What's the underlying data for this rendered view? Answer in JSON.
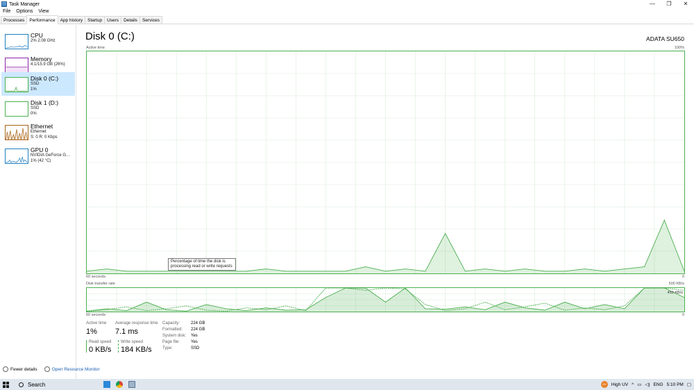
{
  "window": {
    "title": "Task Manager",
    "minimize": "—",
    "restore": "❐",
    "close": "✕"
  },
  "menu": [
    "File",
    "Options",
    "View"
  ],
  "tabs": [
    "Processes",
    "Performance",
    "App history",
    "Startup",
    "Users",
    "Details",
    "Services"
  ],
  "active_tab": "Performance",
  "sidebar": [
    {
      "name": "CPU",
      "sub1": "2% 2.08 GHz",
      "sub2": "",
      "sub3": "",
      "color": "#1f7fbf"
    },
    {
      "name": "Memory",
      "sub1": "4.1/15.9 GB (26%)",
      "sub2": "",
      "sub3": "",
      "color": "#8b24a8"
    },
    {
      "name": "Disk 0 (C:)",
      "sub1": "SSD",
      "sub2": "1%",
      "sub3": "",
      "color": "#4caf50"
    },
    {
      "name": "Disk 1 (D:)",
      "sub1": "SSD",
      "sub2": "0%",
      "sub3": "",
      "color": "#4caf50"
    },
    {
      "name": "Ethernet",
      "sub1": "Ethernet",
      "sub2": "S: 0 R: 0 Kbps",
      "sub3": "",
      "color": "#a7641c"
    },
    {
      "name": "GPU 0",
      "sub1": "NVIDIA GeForce G...",
      "sub2": "1% (42 °C)",
      "sub3": "",
      "color": "#1f7fbf"
    }
  ],
  "main": {
    "title": "Disk 0 (C:)",
    "model": "ADATA SU650",
    "active_time_label": "Active time",
    "active_max": "100%",
    "chart1_xlabel": "60 seconds",
    "chart1_xend": "0",
    "transfer_label": "Disk transfer rate",
    "transfer_max": "500 KB/s",
    "transfer_mid": "450 KB/s",
    "chart2_xlabel": "60 seconds",
    "chart2_xend": "0",
    "tooltip": "Percentage of time the disk is processing read or write requests"
  },
  "stats": {
    "active_time_label": "Active time",
    "active_time_value": "1%",
    "avg_resp_label": "Average response time",
    "avg_resp_value": "7.1 ms",
    "read_label": "Read speed",
    "read_value": "0 KB/s",
    "write_label": "Write speed",
    "write_value": "184 KB/s",
    "props": [
      {
        "k": "Capacity:",
        "v": "224 GB"
      },
      {
        "k": "Formatted:",
        "v": "224 GB"
      },
      {
        "k": "System disk:",
        "v": "Yes"
      },
      {
        "k": "Page file:",
        "v": "Yes"
      },
      {
        "k": "Type:",
        "v": "SSD"
      }
    ]
  },
  "footer": {
    "fewer": "Fewer details",
    "resmon": "Open Resource Monitor"
  },
  "taskbar": {
    "search": "Search",
    "weather": "High UV",
    "lang": "ENG",
    "time": "5:10 PM"
  },
  "chart_data": [
    {
      "type": "area",
      "title": "Active time",
      "ylim": [
        0,
        100
      ],
      "x": [
        60,
        58,
        56,
        54,
        52,
        50,
        48,
        46,
        44,
        42,
        40,
        38,
        36,
        34,
        32,
        30,
        28,
        26,
        24,
        22,
        20,
        18,
        16,
        14,
        12,
        10,
        8,
        6,
        4,
        2,
        0
      ],
      "values": [
        1,
        2,
        1,
        1,
        1,
        1,
        1,
        1,
        1,
        2,
        1,
        1,
        1,
        1,
        3,
        1,
        2,
        1,
        18,
        1,
        2,
        1,
        2,
        1,
        1,
        2,
        1,
        2,
        3,
        24,
        1
      ],
      "grid": true
    },
    {
      "type": "area",
      "title": "Disk transfer rate",
      "ylim": [
        0,
        500
      ],
      "series": [
        {
          "name": "Read speed",
          "values": [
            10,
            60,
            20,
            200,
            40,
            10,
            150,
            60,
            20,
            80,
            30,
            40,
            300,
            500,
            500,
            200,
            500,
            60,
            50,
            100,
            40,
            200,
            80,
            30,
            200,
            60,
            150,
            60,
            500,
            500,
            300
          ]
        },
        {
          "name": "Write speed",
          "values": [
            5,
            40,
            100,
            20,
            60,
            120,
            30,
            10,
            80,
            40,
            120,
            20,
            500,
            500,
            450,
            500,
            480,
            150,
            20,
            60,
            200,
            40,
            100,
            180,
            30,
            80,
            40,
            120,
            500,
            500,
            450
          ]
        }
      ],
      "grid": true
    }
  ]
}
